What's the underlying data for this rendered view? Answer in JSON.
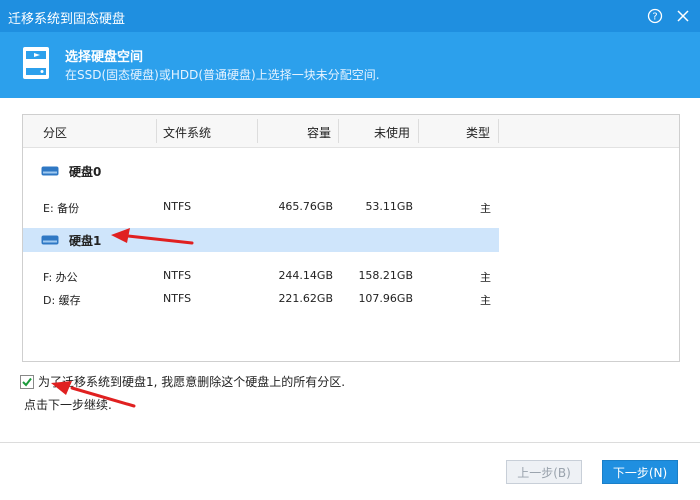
{
  "window": {
    "title": "迁移系统到固态硬盘",
    "help_symbol": "?"
  },
  "header": {
    "title": "选择硬盘空间",
    "subtitle": "在SSD(固态硬盘)或HDD(普通硬盘)上选择一块未分配空间."
  },
  "table": {
    "columns": [
      "分区",
      "文件系统",
      "容量",
      "未使用",
      "类型"
    ],
    "disks": [
      {
        "label": "硬盘0",
        "selected": false,
        "partitions": [
          {
            "name": "E: 备份",
            "fs": "NTFS",
            "capacity": "465.76GB",
            "free": "53.11GB",
            "type": "主"
          }
        ]
      },
      {
        "label": "硬盘1",
        "selected": true,
        "partitions": [
          {
            "name": "F: 办公",
            "fs": "NTFS",
            "capacity": "244.14GB",
            "free": "158.21GB",
            "type": "主"
          },
          {
            "name": "D: 缓存",
            "fs": "NTFS",
            "capacity": "221.62GB",
            "free": "107.96GB",
            "type": "主"
          }
        ]
      }
    ]
  },
  "confirm": {
    "checked": true,
    "text": "为了迁移系统到硬盘1, 我愿意删除这个硬盘上的所有分区.",
    "hint": "点击下一步继续."
  },
  "buttons": {
    "prev": "上一步(B)",
    "next": "下一步(N)"
  },
  "colors": {
    "titlebar": "#1f8fe0",
    "header": "#2ca0ec",
    "selected_row": "#cfe5fb",
    "annotation_arrow": "#e02020"
  }
}
